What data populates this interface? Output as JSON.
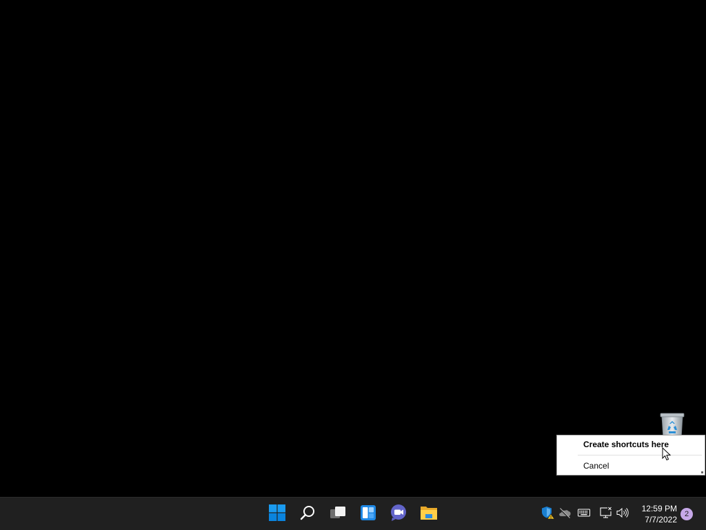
{
  "desktop": {
    "icons": [
      {
        "name": "Recycle Bin",
        "icon": "recycle-bin-icon"
      }
    ]
  },
  "context_menu": {
    "items": [
      {
        "label": "Create shortcuts here",
        "bold": true
      },
      {
        "label": "Cancel",
        "bold": false
      }
    ]
  },
  "taskbar": {
    "pinned": [
      {
        "name": "Start",
        "icon": "windows-logo-icon"
      },
      {
        "name": "Search",
        "icon": "search-icon"
      },
      {
        "name": "Task View",
        "icon": "task-view-icon"
      },
      {
        "name": "Widgets",
        "icon": "widgets-icon"
      },
      {
        "name": "Chat",
        "icon": "chat-icon"
      },
      {
        "name": "File Explorer",
        "icon": "folder-icon"
      }
    ],
    "tray": [
      {
        "name": "Windows Security",
        "icon": "shield-warning-icon"
      },
      {
        "name": "OneDrive",
        "icon": "onedrive-icon"
      },
      {
        "name": "Touch keyboard",
        "icon": "keyboard-icon"
      },
      {
        "name": "Network",
        "icon": "network-icon"
      },
      {
        "name": "Volume",
        "icon": "volume-icon"
      }
    ],
    "clock": {
      "time": "12:59 PM",
      "date": "7/7/2022"
    },
    "notification_count": "2"
  },
  "colors": {
    "taskbar_bg": "#202020",
    "accent": "#0078d4",
    "badge": "#c6a8e8"
  }
}
